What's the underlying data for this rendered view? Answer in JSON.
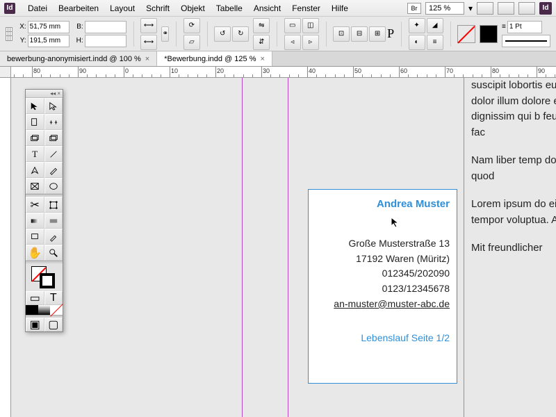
{
  "menu": {
    "items": [
      "Datei",
      "Bearbeiten",
      "Layout",
      "Schrift",
      "Objekt",
      "Tabelle",
      "Ansicht",
      "Fenster",
      "Hilfe"
    ],
    "br": "Br",
    "zoom": "125 %",
    "id": "Id"
  },
  "controls": {
    "x_label": "X:",
    "y_label": "Y:",
    "x_value": "51,75 mm",
    "y_value": "191,5 mm",
    "b_label": "B:",
    "h_label": "H:",
    "stroke_weight": "1 Pt"
  },
  "tabs": [
    {
      "label": "bewerbung-anonymisiert.indd @ 100 %",
      "active": false
    },
    {
      "label": "*Bewerbung.indd @ 125 %",
      "active": true
    }
  ],
  "ruler": {
    "marks": [
      "70",
      "80",
      "90",
      "0",
      "10",
      "20",
      "30",
      "40",
      "50",
      "60",
      "70",
      "80",
      "90"
    ]
  },
  "card": {
    "name": "Andrea Muster",
    "street": "Große Musterstraße 13",
    "city": "17192 Waren (Müritz)",
    "phone": "012345/202090",
    "mobile": "0123/12345678",
    "email": "an-muster@muster-abc.de",
    "pageinfo": "Lebenslauf Seite 1/2"
  },
  "body": {
    "p1": "suscipit lobortis eum iriure dolor illum dolore eu dignissim qui b feugait nulla fac",
    "p2": "Nam liber temp doming id quod",
    "p3": "Lorem ipsum do eirmod tempor voluptua. At ve amet.",
    "p4": "Mit freundlicher"
  },
  "colors": {
    "guide_magenta": "#b847c7",
    "guide_cyan": "#3fb5b5",
    "frame_blue": "#2f8fd8"
  }
}
